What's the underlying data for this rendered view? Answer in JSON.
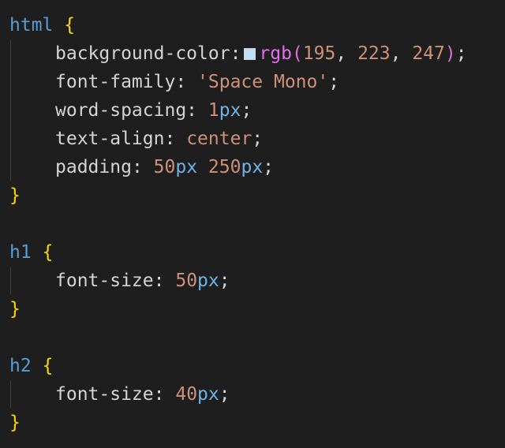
{
  "swatch_color": "#c3dff7",
  "blocks": {
    "html": {
      "selector": "html",
      "props": {
        "background_color": {
          "name": "background-color",
          "fn": "rgb",
          "args": [
            "195",
            "223",
            "247"
          ]
        },
        "font_family": {
          "name": "font-family",
          "value": "'Space Mono'"
        },
        "word_spacing": {
          "name": "word-spacing",
          "num": "1",
          "unit": "px"
        },
        "text_align": {
          "name": "text-align",
          "value": "center"
        },
        "padding": {
          "name": "padding",
          "num1": "50",
          "unit1": "px",
          "num2": "250",
          "unit2": "px"
        }
      }
    },
    "h1": {
      "selector": "h1",
      "font_size": {
        "name": "font-size",
        "num": "50",
        "unit": "px"
      }
    },
    "h2": {
      "selector": "h2",
      "font_size": {
        "name": "font-size",
        "num": "40",
        "unit": "px"
      }
    }
  },
  "punct": {
    "open": "{",
    "close": "}",
    "colon": ":",
    "semi": ";",
    "lparen": "(",
    "rparen": ")",
    "comma": ", "
  }
}
